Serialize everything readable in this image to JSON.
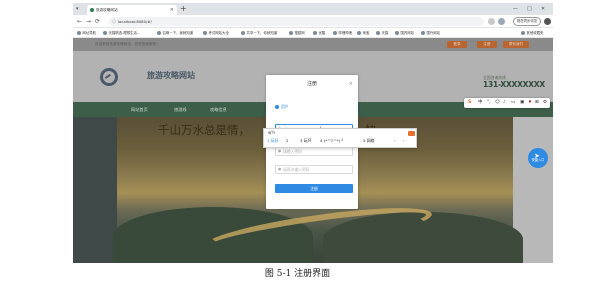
{
  "browser": {
    "tab_title": "旅游攻略网站",
    "url": "localhost:8080/#/",
    "profile_label": "现在同步浏览",
    "bookmarks": [
      "网址导航",
      "天猫精选-理想生活…",
      "召唤一下，我就知道",
      "考试网站大全",
      "共享一下，你就知道",
      "搜狐网",
      "优酷",
      "哔哩哔哩",
      "淘宝",
      "天猫",
      "国内网站",
      "国外网站"
    ],
    "right_bookmark": "其他收藏夹"
  },
  "site": {
    "notice": "欢迎来到旅游攻略网站，祝您旅途愉快！",
    "top_buttons": [
      "登录",
      "注册",
      "联系我们"
    ],
    "title": "旅游攻略网站",
    "phone_label": "全国咨询热线",
    "phone": "131-XXXXXXXX",
    "nav": [
      "网站首页",
      "旅游线",
      "攻略信息"
    ],
    "slogan_left": "千山万水总是情，",
    "slogan_right": "快",
    "float_label": "快捷入口"
  },
  "modal": {
    "title": "注册",
    "close": "×",
    "radio_label": "用户",
    "username_value": "wh",
    "password_placeholder": "请输入密码",
    "confirm_placeholder": "请再次输入密码",
    "submit_label": "注册"
  },
  "ime": {
    "composition": "w'h",
    "candidates": [
      "1 玩好",
      "2 ",
      "3 玩坏",
      "4 (*^▽^*) ╯",
      "5 网络"
    ],
    "prev": "‹",
    "next": "›"
  },
  "caption": "图 5-1 注册界面",
  "colors": {
    "accent": "#2f8ae3",
    "nav_green": "#3d5e49",
    "top_button": "#b9652f"
  }
}
